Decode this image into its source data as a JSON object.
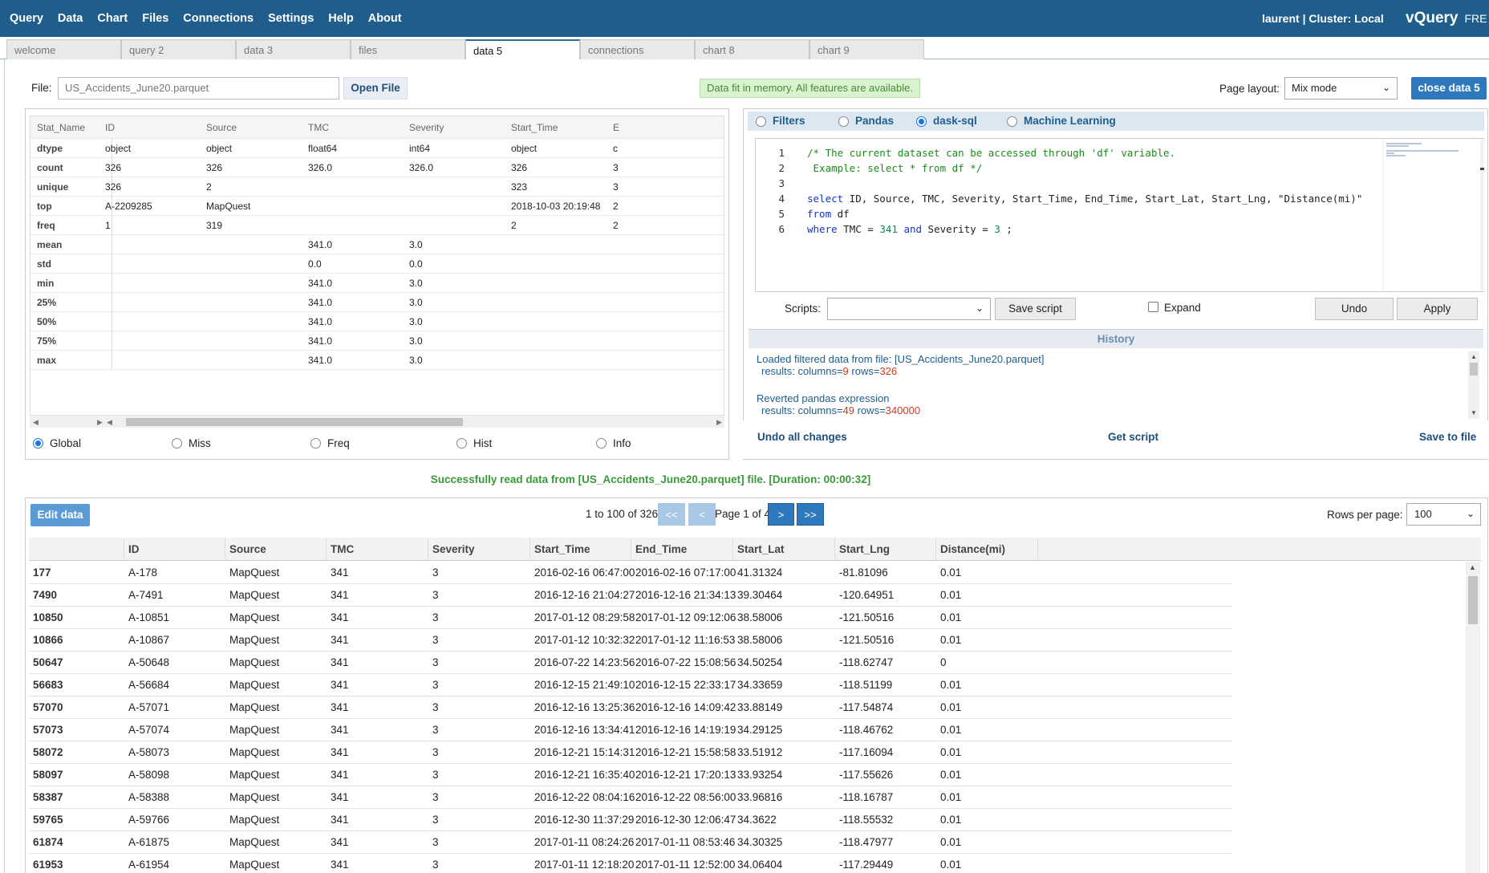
{
  "menu": [
    "Query",
    "Data",
    "Chart",
    "Files",
    "Connections",
    "Settings",
    "Help",
    "About"
  ],
  "user_info": "laurent | Cluster: Local",
  "brand": "vQuery",
  "brand_suffix": "FRE",
  "tabs": [
    "welcome",
    "query 2",
    "data 3",
    "files",
    "data 5",
    "connections",
    "chart 8",
    "chart 9"
  ],
  "active_tab": "data 5",
  "file": {
    "label": "File:",
    "placeholder": "US_Accidents_June20.parquet",
    "open_label": "Open File"
  },
  "memory_message": "Data fit in memory. All features are available.",
  "page_layout": {
    "label": "Page layout:",
    "value": "Mix mode"
  },
  "close_label": "close data 5",
  "stats": {
    "columns": [
      "Stat_Name",
      "ID",
      "Source",
      "TMC",
      "Severity",
      "Start_Time",
      "E"
    ],
    "rows": [
      {
        "name": "dtype",
        "values": [
          "object",
          "object",
          "float64",
          "int64",
          "object",
          "c"
        ]
      },
      {
        "name": "count",
        "values": [
          "326",
          "326",
          "326.0",
          "326.0",
          "326",
          "3"
        ]
      },
      {
        "name": "unique",
        "values": [
          "326",
          "2",
          "",
          "",
          "323",
          "3"
        ]
      },
      {
        "name": "top",
        "values": [
          "A-2209285",
          "MapQuest",
          "",
          "",
          "2018-10-03 20:19:48",
          "2"
        ]
      },
      {
        "name": "freq",
        "values": [
          "1",
          "319",
          "",
          "",
          "2",
          "2"
        ]
      },
      {
        "name": "mean",
        "values": [
          "",
          "",
          "341.0",
          "3.0",
          "",
          ""
        ]
      },
      {
        "name": "std",
        "values": [
          "",
          "",
          "0.0",
          "0.0",
          "",
          ""
        ]
      },
      {
        "name": "min",
        "values": [
          "",
          "",
          "341.0",
          "3.0",
          "",
          ""
        ]
      },
      {
        "name": "25%",
        "values": [
          "",
          "",
          "341.0",
          "3.0",
          "",
          ""
        ]
      },
      {
        "name": "50%",
        "values": [
          "",
          "",
          "341.0",
          "3.0",
          "",
          ""
        ]
      },
      {
        "name": "75%",
        "values": [
          "",
          "",
          "341.0",
          "3.0",
          "",
          ""
        ]
      },
      {
        "name": "max",
        "values": [
          "",
          "",
          "341.0",
          "3.0",
          "",
          ""
        ]
      }
    ],
    "modes": [
      "Global",
      "Miss",
      "Freq",
      "Hist",
      "Info"
    ],
    "selected_mode": "Global"
  },
  "query": {
    "modes": [
      "Filters",
      "Pandas",
      "dask-sql",
      "Machine Learning"
    ],
    "selected_mode": "dask-sql",
    "line_numbers": [
      "1",
      "2",
      "3",
      "4",
      "5",
      "6"
    ],
    "code": {
      "l1": "/* The current dataset can be accessed through 'df' variable.",
      "l2": " Example: select * from df */",
      "l4_kw": "select",
      "l4_rest": " ID, Source, TMC, Severity, Start_Time, End_Time, Start_Lat, Start_Lng, \"Distance(mi)\"",
      "l5_kw": "from",
      "l5_rest": " df",
      "l6_kw": "where",
      "l6_a": " TMC = ",
      "l6_n1": "341",
      "l6_and": "and",
      "l6_b": " Severity = ",
      "l6_n2": "3",
      "l6_c": " ;"
    },
    "scripts_label": "Scripts:",
    "scripts_value": "",
    "save_script": "Save script",
    "expand_label": "Expand",
    "undo": "Undo",
    "apply": "Apply"
  },
  "history": {
    "title": "History",
    "entries": [
      {
        "text": "Loaded filtered data from file: [US_Accidents_June20.parquet]",
        "results_label": "results:",
        "columns_label": "columns=",
        "columns": "9",
        "rows_label": "rows=",
        "rows": "326"
      },
      {
        "text": "Reverted pandas expression",
        "results_label": "results:",
        "columns_label": "columns=",
        "columns": "49",
        "rows_label": "rows=",
        "rows": "340000"
      }
    ],
    "undo_all": "Undo all changes",
    "get_script": "Get script",
    "save_file": "Save to file"
  },
  "success_message": "Successfully read data from [US_Accidents_June20.parquet] file. [Duration: 00:00:32]",
  "grid": {
    "edit_label": "Edit data",
    "range_text": "1 to 100 of 326",
    "page_text": "Page 1 of 4",
    "first_label": "<<",
    "prev_label": "<",
    "next_label": ">",
    "last_label": ">>",
    "rows_per_page_label": "Rows per page:",
    "rows_per_page": "100",
    "columns": [
      "",
      "ID",
      "Source",
      "TMC",
      "Severity",
      "Start_Time",
      "End_Time",
      "Start_Lat",
      "Start_Lng",
      "Distance(mi)"
    ],
    "rows": [
      [
        "177",
        "A-178",
        "MapQuest",
        "341",
        "3",
        "2016-02-16 06:47:00",
        "2016-02-16 07:17:00",
        "41.31324",
        "-81.81096",
        "0.01"
      ],
      [
        "7490",
        "A-7491",
        "MapQuest",
        "341",
        "3",
        "2016-12-16 21:04:27",
        "2016-12-16 21:34:13",
        "39.30464",
        "-120.64951",
        "0.01"
      ],
      [
        "10850",
        "A-10851",
        "MapQuest",
        "341",
        "3",
        "2017-01-12 08:29:58",
        "2017-01-12 09:12:06",
        "38.58006",
        "-121.50516",
        "0.01"
      ],
      [
        "10866",
        "A-10867",
        "MapQuest",
        "341",
        "3",
        "2017-01-12 10:32:32",
        "2017-01-12 11:16:53",
        "38.58006",
        "-121.50516",
        "0.01"
      ],
      [
        "50647",
        "A-50648",
        "MapQuest",
        "341",
        "3",
        "2016-07-22 14:23:56",
        "2016-07-22 15:08:56",
        "34.50254",
        "-118.62747",
        "0"
      ],
      [
        "56683",
        "A-56684",
        "MapQuest",
        "341",
        "3",
        "2016-12-15 21:49:10",
        "2016-12-15 22:33:17",
        "34.33659",
        "-118.51199",
        "0.01"
      ],
      [
        "57070",
        "A-57071",
        "MapQuest",
        "341",
        "3",
        "2016-12-16 13:25:36",
        "2016-12-16 14:09:42",
        "33.88149",
        "-117.54874",
        "0.01"
      ],
      [
        "57073",
        "A-57074",
        "MapQuest",
        "341",
        "3",
        "2016-12-16 13:34:41",
        "2016-12-16 14:19:19",
        "34.29125",
        "-118.46762",
        "0.01"
      ],
      [
        "58072",
        "A-58073",
        "MapQuest",
        "341",
        "3",
        "2016-12-21 15:14:31",
        "2016-12-21 15:58:58",
        "33.51912",
        "-117.16094",
        "0.01"
      ],
      [
        "58097",
        "A-58098",
        "MapQuest",
        "341",
        "3",
        "2016-12-21 16:35:40",
        "2016-12-21 17:20:13",
        "33.93254",
        "-117.55626",
        "0.01"
      ],
      [
        "58387",
        "A-58388",
        "MapQuest",
        "341",
        "3",
        "2016-12-22 08:04:16",
        "2016-12-22 08:56:00",
        "33.96816",
        "-118.16787",
        "0.01"
      ],
      [
        "59765",
        "A-59766",
        "MapQuest",
        "341",
        "3",
        "2016-12-30 11:37:29",
        "2016-12-30 12:06:47",
        "34.3622",
        "-118.55532",
        "0.01"
      ],
      [
        "61874",
        "A-61875",
        "MapQuest",
        "341",
        "3",
        "2017-01-11 08:24:26",
        "2017-01-11 08:53:46",
        "34.30325",
        "-118.47977",
        "0.01"
      ],
      [
        "61953",
        "A-61954",
        "MapQuest",
        "341",
        "3",
        "2017-01-11 12:18:20",
        "2017-01-11 12:52:00",
        "34.06404",
        "-117.29449",
        "0.01"
      ]
    ]
  },
  "colors": {
    "header_bg": "#1f5d8c",
    "accent_button": "#2e78bd",
    "success_green": "#3a9a3a",
    "history_red": "#d8391e"
  }
}
